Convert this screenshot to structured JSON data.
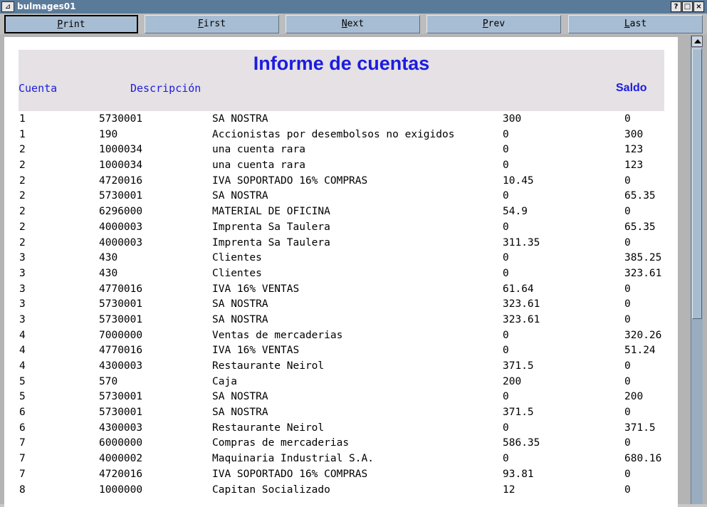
{
  "window": {
    "title": "bulmages01",
    "app_icon": "app-window-icon",
    "controls": {
      "help": "?",
      "maximize": "□",
      "close": "×"
    }
  },
  "toolbar": {
    "buttons": [
      {
        "mnemonic": "P",
        "rest": "rint",
        "active": true
      },
      {
        "mnemonic": "F",
        "rest": "irst",
        "active": false
      },
      {
        "mnemonic": "N",
        "rest": "ext",
        "active": false
      },
      {
        "mnemonic": "P",
        "rest": "rev",
        "active": false
      },
      {
        "mnemonic": "L",
        "rest": "ast",
        "active": false
      }
    ]
  },
  "report": {
    "title": "Informe de cuentas",
    "columns": {
      "cuenta": "Cuenta",
      "descripcion": "Descripción",
      "saldo": "Saldo"
    },
    "rows": [
      [
        "1",
        "5730001",
        "SA NOSTRA",
        "300",
        "0"
      ],
      [
        "1",
        "190",
        "Accionistas por desembolsos no exigidos",
        "0",
        "300"
      ],
      [
        "2",
        "1000034",
        "una cuenta rara",
        "0",
        "123"
      ],
      [
        "2",
        "1000034",
        "una cuenta rara",
        "0",
        "123"
      ],
      [
        "2",
        "4720016",
        "IVA SOPORTADO 16% COMPRAS",
        "10.45",
        "0"
      ],
      [
        "2",
        "5730001",
        "SA NOSTRA",
        "0",
        "65.35"
      ],
      [
        "2",
        "6296000",
        "MATERIAL DE OFICINA",
        "54.9",
        "0"
      ],
      [
        "2",
        "4000003",
        "Imprenta Sa Taulera",
        "0",
        "65.35"
      ],
      [
        "2",
        "4000003",
        "Imprenta Sa Taulera",
        "311.35",
        "0"
      ],
      [
        "3",
        "430",
        "Clientes",
        "0",
        "385.25"
      ],
      [
        "3",
        "430",
        "Clientes",
        "0",
        "323.61"
      ],
      [
        "3",
        "4770016",
        "IVA 16% VENTAS",
        "61.64",
        "0"
      ],
      [
        "3",
        "5730001",
        "SA NOSTRA",
        "323.61",
        "0"
      ],
      [
        "3",
        "5730001",
        "SA NOSTRA",
        "323.61",
        "0"
      ],
      [
        "4",
        "7000000",
        "Ventas de mercaderias",
        "0",
        "320.26"
      ],
      [
        "4",
        "4770016",
        "IVA 16% VENTAS",
        "0",
        "51.24"
      ],
      [
        "4",
        "4300003",
        "Restaurante Neirol",
        "371.5",
        "0"
      ],
      [
        "5",
        "570",
        "Caja",
        "200",
        "0"
      ],
      [
        "5",
        "5730001",
        "SA NOSTRA",
        "0",
        "200"
      ],
      [
        "6",
        "5730001",
        "SA NOSTRA",
        "371.5",
        "0"
      ],
      [
        "6",
        "4300003",
        "Restaurante Neirol",
        "0",
        "371.5"
      ],
      [
        "7",
        "6000000",
        "Compras de mercaderias",
        "586.35",
        "0"
      ],
      [
        "7",
        "4000002",
        "Maquinaria Industrial S.A.",
        "0",
        "680.16"
      ],
      [
        "7",
        "4720016",
        "IVA SOPORTADO 16% COMPRAS",
        "93.81",
        "0"
      ],
      [
        "8",
        "1000000",
        "Capitan Socializado",
        "12",
        "0"
      ]
    ]
  },
  "scrollbar": {
    "position": 0.0
  }
}
